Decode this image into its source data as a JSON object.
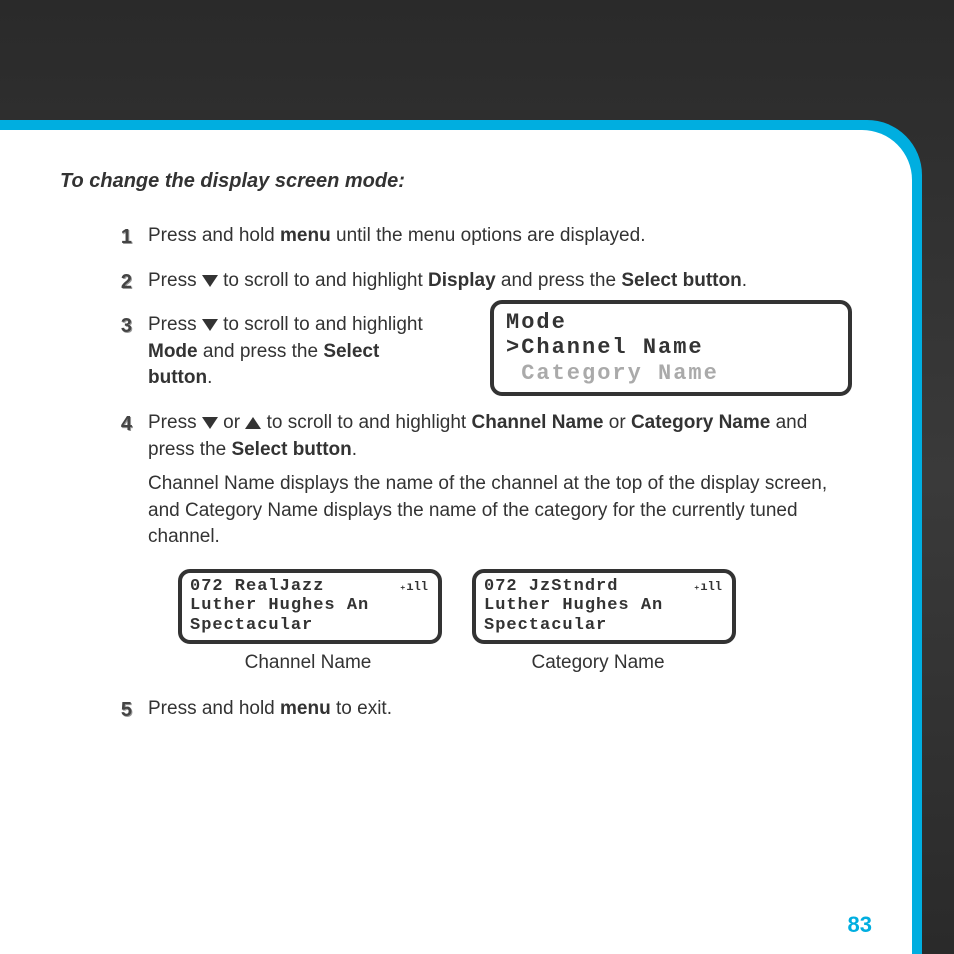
{
  "heading": "To change the display screen mode:",
  "steps": {
    "n1": "1",
    "s1a": "Press and hold ",
    "s1b": "menu",
    "s1c": " until the menu options are displayed.",
    "n2": "2",
    "s2a": "Press ",
    "s2b": " to scroll to and highlight ",
    "s2c": "Display",
    "s2d": " and press the ",
    "s2e": "Select button",
    "s2f": ".",
    "n3": "3",
    "s3a": "Press ",
    "s3b": " to scroll to and highlight ",
    "s3c": "Mode",
    "s3d": " and press the ",
    "s3e": "Select button",
    "s3f": ".",
    "n4": "4",
    "s4a": "Press ",
    "s4b": " or ",
    "s4c": " to scroll to and highlight ",
    "s4d": "Channel Name",
    "s4e": " or ",
    "s4f": "Category Name",
    "s4g": " and press the ",
    "s4h": "Select button",
    "s4i": ".",
    "explain": "Channel Name displays the name of the channel at the top of the display screen, and Category Name displays the name of the category for the currently tuned channel.",
    "n5": "5",
    "s5a": "Press and hold ",
    "s5b": "menu",
    "s5c": " to exit."
  },
  "lcd_mode": {
    "line1": "Mode",
    "line2": ">Channel Name",
    "line3": " Category Name"
  },
  "lcd_left": {
    "line1": "072 RealJazz",
    "line2": "Luther Hughes An",
    "line3": "Spectacular",
    "signal": "₊ıll"
  },
  "lcd_right": {
    "line1": "072 JzStndrd",
    "line2": "Luther Hughes An",
    "line3": "Spectacular",
    "signal": "₊ıll"
  },
  "captions": {
    "left": "Channel Name",
    "right": "Category Name"
  },
  "page_number": "83"
}
